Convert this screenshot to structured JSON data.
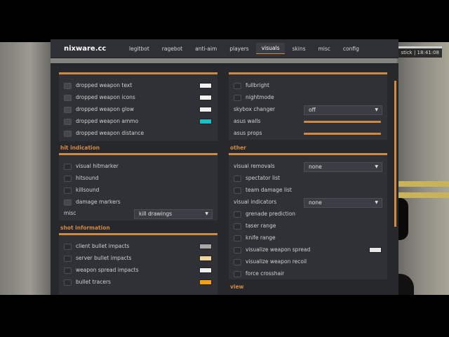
{
  "header": {
    "brand": "nixware.cc",
    "tabs": [
      {
        "label": "legitbot",
        "active": false
      },
      {
        "label": "ragebot",
        "active": false
      },
      {
        "label": "anti-aim",
        "active": false
      },
      {
        "label": "players",
        "active": false
      },
      {
        "label": "visuals",
        "active": true
      },
      {
        "label": "skins",
        "active": false
      },
      {
        "label": "misc",
        "active": false
      },
      {
        "label": "config",
        "active": false
      }
    ]
  },
  "hud": {
    "stick_label": "stick | 18:41:08"
  },
  "left": {
    "world_items": [
      {
        "label": "dropped weapon text",
        "color": "#f2f2f2"
      },
      {
        "label": "dropped weapon icons",
        "color": "#f2f2f2"
      },
      {
        "label": "dropped weapon glow",
        "color": "#f2f2f2"
      },
      {
        "label": "dropped weapon ammo",
        "color": "#1fbdc4"
      },
      {
        "label": "dropped weapon distance",
        "color": ""
      }
    ],
    "hit_indication": {
      "title": "hit indication",
      "items": [
        "visual hitmarker",
        "hitsound",
        "killsound",
        "damage markers"
      ],
      "misc_label": "misc",
      "misc_value": "kill drawings"
    },
    "shot_information": {
      "title": "shot information",
      "items": [
        {
          "label": "client bullet impacts",
          "color": "#a9a9a9"
        },
        {
          "label": "server bullet impacts",
          "color": "#f0d29a"
        },
        {
          "label": "weapon spread impacts",
          "color": "#f2f2f2"
        },
        {
          "label": "bullet tracers",
          "color": "#f5a20f"
        }
      ]
    }
  },
  "right": {
    "top_items": [
      {
        "type": "checkbox",
        "label": "fullbright"
      },
      {
        "type": "checkbox",
        "label": "nightmode"
      },
      {
        "type": "dropdown",
        "label": "skybox changer",
        "value": "off"
      },
      {
        "type": "slider",
        "label": "asus walls",
        "value": 1.0
      },
      {
        "type": "slider",
        "label": "asus props",
        "value": 1.0
      }
    ],
    "other": {
      "title": "other",
      "visual_removals_label": "visual removals",
      "visual_removals_value": "none",
      "items_a": [
        "spectator list",
        "team damage list"
      ],
      "visual_indicators_label": "visual indicators",
      "visual_indicators_value": "none",
      "items_b": [
        {
          "label": "grenade prediction",
          "color": ""
        },
        {
          "label": "taser range",
          "color": ""
        },
        {
          "label": "knife range",
          "color": ""
        },
        {
          "label": "visualize weapon spread",
          "color": "#e8e8e8"
        },
        {
          "label": "visualize weapon recoil",
          "color": ""
        },
        {
          "label": "force crosshair",
          "color": ""
        }
      ]
    },
    "view_title": "view"
  },
  "colors": {
    "accent": "#d08a3f",
    "panel": "#26282c",
    "group": "#2f3136"
  }
}
